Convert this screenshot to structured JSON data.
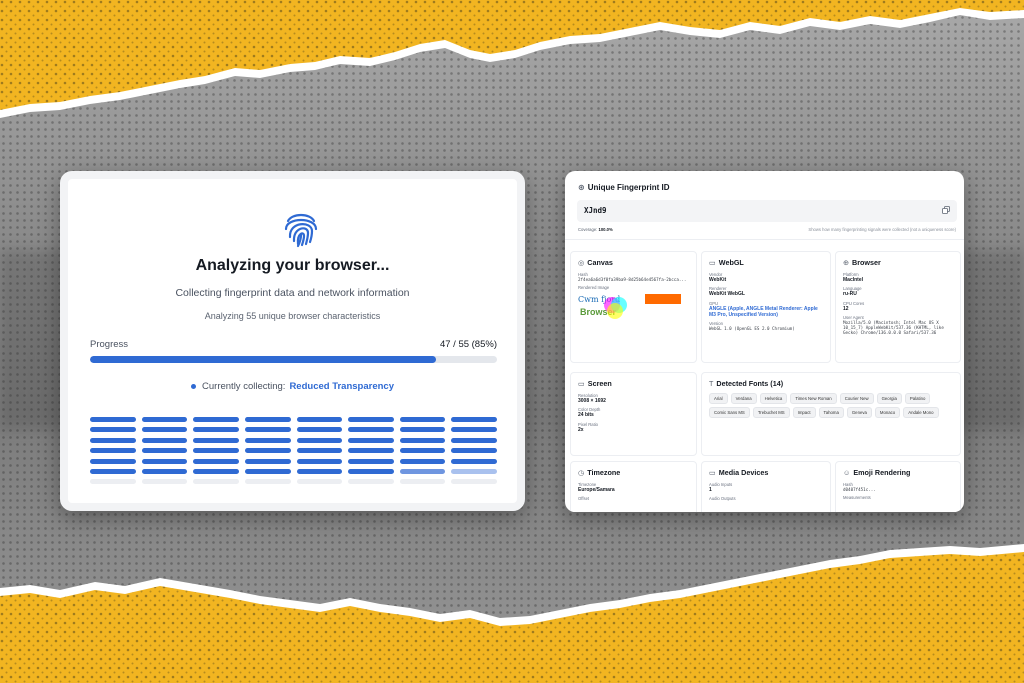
{
  "left_card": {
    "title": "Analyzing your browser...",
    "subtitle": "Collecting fingerprint data and network information",
    "analyzing_text": "Analyzing 55 unique browser characteristics",
    "progress_label": "Progress",
    "progress_count": "47 / 55 (85%)",
    "progress_fraction": 0.85,
    "collecting_label": "Currently collecting:",
    "collecting_value": "Reduced Transparency"
  },
  "right_card": {
    "header": "Unique Fingerprint ID",
    "fingerprint_id": "XJnd9",
    "coverage_label": "Coverage:",
    "coverage_value": "100.0%",
    "coverage_note": "Shows how many fingerprinting signals were collected (not a uniqueness score)",
    "canvas": {
      "title": "Canvas",
      "hash_label": "Hash",
      "hash_value": "2f4ea6a6d3f0fa39ba9-8d25b64e4567fa-2bcca...",
      "rendered_label": "Rendered Image",
      "image_text_1": "Cwm fjord",
      "image_text_2": "Browser"
    },
    "webgl": {
      "title": "WebGL",
      "vendor_label": "Vendor",
      "vendor_value": "WebKit",
      "renderer_label": "Renderer",
      "renderer_value": "WebKit WebGL",
      "gpu_label": "GPU",
      "gpu_value": "ANGLE (Apple, ANGLE Metal Renderer: Apple M3 Pro, Unspecified Version)",
      "version_label": "Version",
      "version_value": "WebGL 1.0 (OpenGL ES 2.0 Chromium)"
    },
    "browser": {
      "title": "Browser",
      "platform_label": "Platform",
      "platform_value": "MacIntel",
      "language_label": "Language",
      "language_value": "ru-RU",
      "cpu_label": "CPU Cores",
      "cpu_value": "12",
      "ua_label": "User Agent",
      "ua_value": "Mozilla/5.0 (Macintosh; Intel Mac OS X 10_15_7) AppleWebKit/537.36 (KHTML, like Gecko) Chrome/136.0.0.0 Safari/537.36"
    },
    "screen": {
      "title": "Screen",
      "resolution_label": "Resolution",
      "resolution_value": "3008 × 1692",
      "depth_label": "Color Depth",
      "depth_value": "24 bits",
      "ratio_label": "Pixel Ratio",
      "ratio_value": "2x"
    },
    "fonts": {
      "title": "Detected Fonts (14)",
      "items": [
        "Arial",
        "Verdana",
        "Helvetica",
        "Times New Roman",
        "Courier New",
        "Georgia",
        "Palatino",
        "Comic Sans MS",
        "Trebuchet MS",
        "Impact",
        "Tahoma",
        "Geneva",
        "Monaco",
        "Andale Mono"
      ]
    },
    "timezone": {
      "title": "Timezone",
      "tz_label": "Timezone",
      "tz_value": "Europe/Samara",
      "offset_label": "Offset"
    },
    "media": {
      "title": "Media Devices",
      "inputs_label": "Audio Inputs",
      "inputs_value": "1",
      "outputs_label": "Audio Outputs"
    },
    "emoji": {
      "title": "Emoji Rendering",
      "hash_label": "Hash",
      "hash_value": "d0407f451c...",
      "measure_label": "Measurements"
    }
  },
  "colors": {
    "accent": "#2f6ad3",
    "yellow": "#f2b521",
    "gray_bg": "#8d8d8d"
  }
}
